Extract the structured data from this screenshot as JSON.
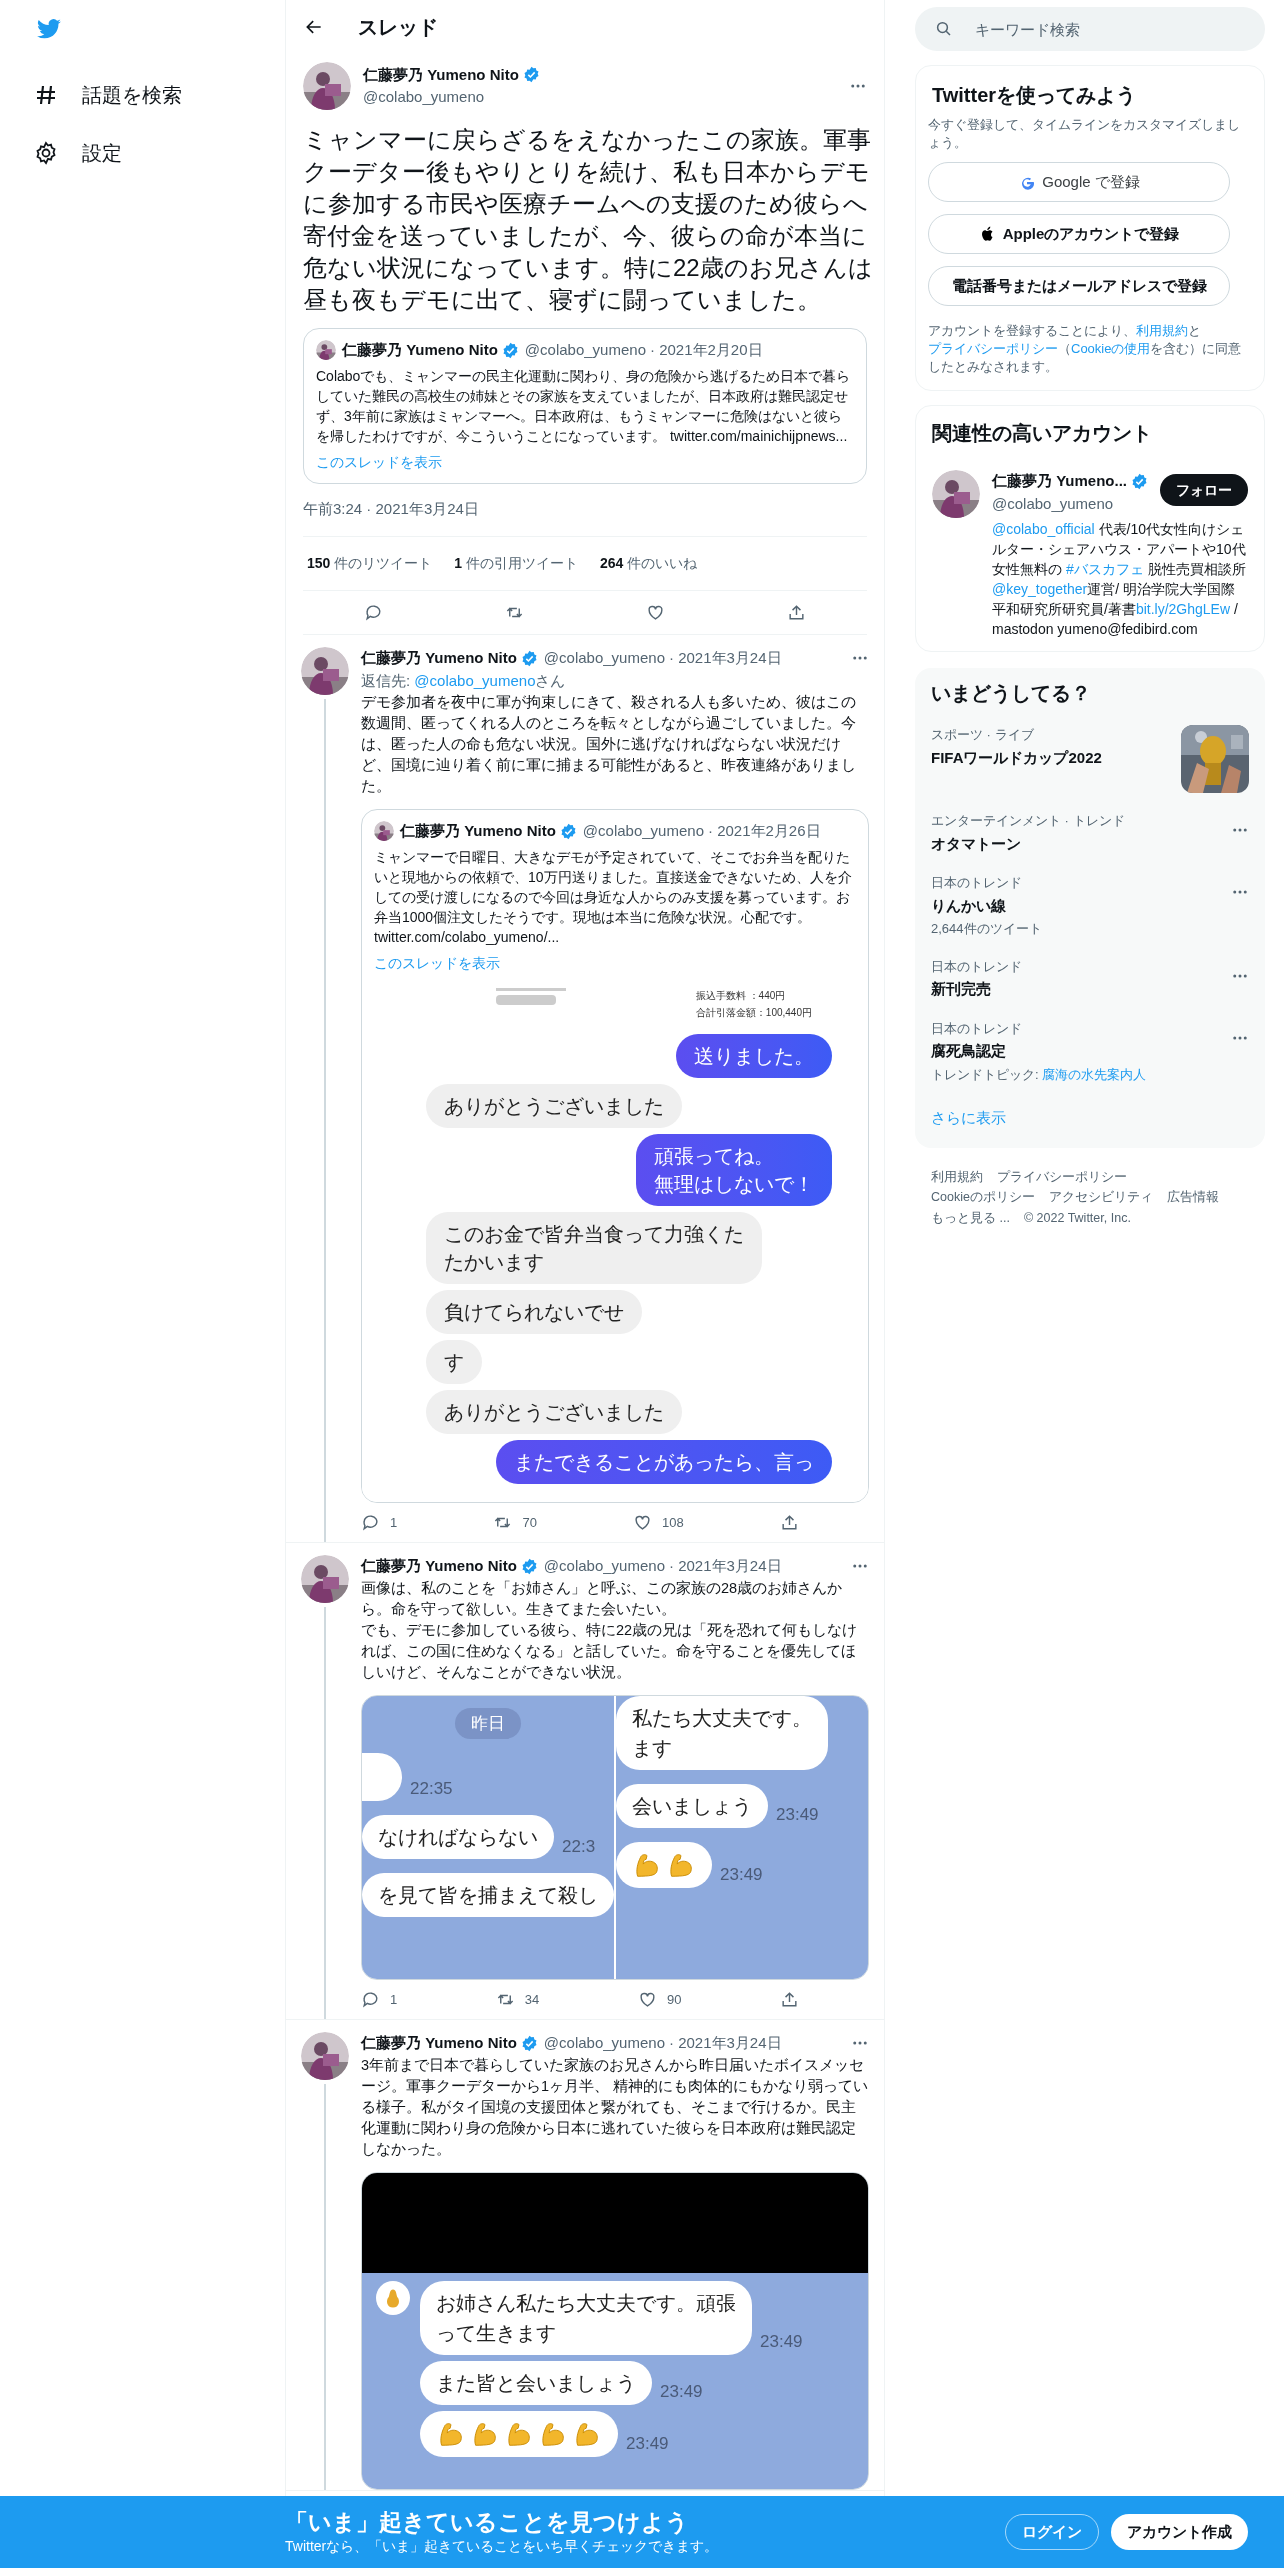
{
  "nav": {
    "items": [
      {
        "label": "話題を検索",
        "kind": "hashtag"
      },
      {
        "label": "設定",
        "kind": "settings"
      }
    ]
  },
  "header": {
    "title": "スレッド"
  },
  "main_tweet": {
    "author": "仁藤夢乃 Yumeno Nito",
    "handle": "@colabo_yumeno",
    "text": "ミャンマーに戻らざるをえなかったこの家族。軍事クーデター後もやりとりを続け、私も日本からデモに参加する市民や医療チームへの支援のため彼らへ寄付金を送っていましたが、今、彼らの命が本当に危ない状況になっています。特に22歳のお兄さんは昼も夜もデモに出て、寝ずに闘っていました。",
    "quote": {
      "author": "仁藤夢乃 Yumeno Nito",
      "handle": "@colabo_yumeno",
      "date": "· 2021年2月20日",
      "text": "Colaboでも、ミャンマーの民主化運動に関わり、身の危険から逃げるため日本で暮らしていた難民の高校生の姉妹とその家族を支えていましたが、日本政府は難民認定せず、3年前に家族はミャンマーへ。日本政府は、もうミャンマーに危険はないと彼らを帰したわけですが、今こういうことになっています。",
      "link": "twitter.com/mainichijpnews...",
      "show_thread": "このスレッドを表示"
    },
    "timestamp": "午前3:24 · 2021年3月24日",
    "stats": [
      {
        "count": "150",
        "label": "件のリツイート"
      },
      {
        "count": "1",
        "label": "件の引用ツイート"
      },
      {
        "count": "264",
        "label": "件のいいね"
      }
    ]
  },
  "replies": [
    {
      "author": "仁藤夢乃 Yumeno Nito",
      "handle": "@colabo_yumeno",
      "date": "· 2021年3月24日",
      "reply_to": {
        "prefix": "返信先: ",
        "link": "@colabo_yumeno",
        "suffix": "さん"
      },
      "paragraphs": [
        "デモ参加者を夜中に軍が拘束しにきて、殺される人も多いため、彼はこの数週間、匿ってくれる人のところを転々としながら過ごしていました。今は、匿った人の命も危ない状況。国外に逃げなければならない状況だけど、国境に辿り着く前に軍に捕まる可能性があると、昨夜連絡がありました。"
      ],
      "quote": {
        "author": "仁藤夢乃 Yumeno Nito",
        "handle": "@colabo_yumeno",
        "date": "· 2021年2月26日",
        "text": "ミャンマーで日曜日、大きなデモが予定されていて、そこでお弁当を配りたいと現地からの依頼で、10万円送りました。直接送金できないため、人を介しての受け渡しになるので今回は身近な人からのみ支援を募っています。お弁当1000個注文したそうです。現地は本当に危険な状況。心配です。",
        "link": "twitter.com/colabo_yumeno/...",
        "show_thread": "このスレッドを表示",
        "media": {
          "kind": "chat",
          "receipt": [
            "振込手数料 ：440円",
            "合計引落金額：100,440円"
          ],
          "messages": [
            {
              "kind": "sent",
              "lines": [
                "送りました。"
              ]
            },
            {
              "kind": "received",
              "lines": [
                "ありがとうございました"
              ]
            },
            {
              "kind": "sent",
              "lines": [
                "頑張ってね。",
                "無理はしないで！"
              ]
            },
            {
              "kind": "received",
              "lines": [
                "このお金で皆弁当食って力強くた",
                "たかいます"
              ]
            },
            {
              "kind": "received",
              "lines": [
                "負けてられないでせ"
              ]
            },
            {
              "kind": "received",
              "lines": [
                "す"
              ]
            },
            {
              "kind": "received",
              "lines": [
                "ありがとうございました"
              ]
            },
            {
              "kind": "sent",
              "lines": [
                "またできることがあったら、言っ"
              ]
            }
          ]
        }
      },
      "actions": {
        "replies": "1",
        "retweets": "70",
        "likes": "108"
      }
    },
    {
      "author": "仁藤夢乃 Yumeno Nito",
      "handle": "@colabo_yumeno",
      "date": "· 2021年3月24日",
      "paragraphs": [
        "画像は、私のことを「お姉さん」と呼ぶ、この家族の28歳のお姉さんから。命を守って欲しい。生きてまた会いたい。",
        "でも、デモに参加している彼ら、特に22歳の兄は「死を恐れて何もしなければ、この国に住めなくなる」と話していた。命を守ることを優先してほしいけど、そんなことができない状況。"
      ],
      "media": {
        "kind": "chat_pair",
        "left": {
          "date": "昨日",
          "messages": [
            {
              "kind": "stub",
              "time": "22:35"
            },
            {
              "kind": "text",
              "lines": [
                "なければならない"
              ],
              "time": "22:3"
            },
            {
              "kind": "text",
              "lines": [
                "を見て皆を捕まえて殺し"
              ]
            }
          ]
        },
        "right": {
          "messages": [
            {
              "kind": "text",
              "lines": [
                "私たち大丈夫です。",
                "ます"
              ]
            },
            {
              "kind": "text",
              "lines": [
                "会いましょう"
              ],
              "time": "23:49"
            },
            {
              "kind": "emoji",
              "emoji": [
                {
                  "kind": "flexed_arm"
                },
                {
                  "kind": "flexed_arm"
                }
              ],
              "time": "23:49"
            }
          ]
        }
      },
      "actions": {
        "replies": "1",
        "retweets": "34",
        "likes": "90"
      }
    },
    {
      "author": "仁藤夢乃 Yumeno Nito",
      "handle": "@colabo_yumeno",
      "date": "· 2021年3月24日",
      "paragraphs": [
        "3年前まで日本で暮らしていた家族のお兄さんから昨日届いたボイスメッセージ。軍事クーデターから1ヶ月半、 精神的にも肉体的にもかなり弱っている様子。私がタイ国境の支援団体と繋がれても、そこまで行けるか。民主化運動に関わり身の危険から日本に逃れていた彼らを日本政府は難民認定しなかった。"
      ],
      "media": {
        "kind": "video",
        "messages": [
          {
            "kind": "text",
            "lines": [
              "お姉さん私たち大丈夫です。頑張",
              "って生きます"
            ],
            "time": "23:49"
          },
          {
            "kind": "text",
            "lines": [
              "また皆と会いましょう"
            ],
            "time": "23:49"
          },
          {
            "kind": "emoji",
            "emoji": [
              {
                "kind": "flexed_arm"
              },
              {
                "kind": "flexed_arm"
              },
              {
                "kind": "flexed_arm"
              },
              {
                "kind": "flexed_arm"
              },
              {
                "kind": "flexed_arm"
              }
            ],
            "time": "23:49"
          }
        ]
      }
    }
  ],
  "search": {
    "placeholder": "キーワード検索"
  },
  "signup": {
    "title": "Twitterを使ってみよう",
    "subtitle": "今すぐ登録して、タイムラインをカスタマイズしましょう。",
    "buttons": [
      {
        "label": "Google で登録",
        "kind": "google"
      },
      {
        "label": "Appleのアカウントで登録",
        "kind": "apple"
      },
      {
        "label": "電話番号またはメールアドレスで登録",
        "kind": "plain"
      }
    ],
    "legal": [
      {
        "text": "アカウントを登録することにより、",
        "link": false
      },
      {
        "text": "利用規約",
        "link": true
      },
      {
        "text": "と",
        "link": false
      },
      {
        "text": "プライバシーポリシー",
        "link": true
      },
      {
        "text": "（",
        "link": false
      },
      {
        "text": "Cookieの使用",
        "link": true
      },
      {
        "text": "を含む）に同意したとみなされます。",
        "link": false
      }
    ]
  },
  "who_to_follow": {
    "title": "関連性の高いアカウント",
    "account": {
      "name": "仁藤夢乃 Yumeno...",
      "handle": "@colabo_yumeno",
      "button": "フォロー",
      "bio": [
        {
          "text": "@colabo_official",
          "link": true
        },
        {
          "text": " 代表/10代女性向けシェルター・シェアハウス・アパートや10代女性無料の ",
          "link": false
        },
        {
          "text": "#バスカフェ",
          "link": true
        },
        {
          "text": " 脱性売買相談所 ",
          "link": false
        },
        {
          "text": "@key_together",
          "link": true
        },
        {
          "text": "運営/ 明治学院大学国際平和研究所研究員/著書",
          "link": false
        },
        {
          "text": "bit.ly/2GhgLEw",
          "link": true
        },
        {
          "text": " /mastodon yumeno@fedibird.com",
          "link": false
        }
      ]
    }
  },
  "trends": {
    "title": "いまどうしてる？",
    "items": [
      {
        "category": "スポーツ · ライブ",
        "name": "FIFAワールドカップ2022"
      },
      {
        "category": "エンターテインメント · トレンド",
        "name": "オタマトーン"
      },
      {
        "category": "日本のトレンド",
        "name": "りんかい線",
        "meta": "2,644件のツイート"
      },
      {
        "category": "日本のトレンド",
        "name": "新刊完売"
      },
      {
        "category": "日本のトレンド",
        "name": "腐死鳥認定",
        "topic_label": "トレンドトピック: ",
        "topic_link": "腐海の水先案内人"
      }
    ],
    "show_more": "さらに表示"
  },
  "footer": {
    "links": [
      "利用規約",
      "プライバシーポリシー",
      "Cookieのポリシー",
      "アクセシビリティ",
      "広告情報",
      "もっと見る ..."
    ],
    "copyright": "© 2022 Twitter, Inc."
  },
  "bottom_bar": {
    "title": "「いま」起きていることを見つけよう",
    "subtitle": "Twitterなら、「いま」起きていることをいち早くチェックできます。",
    "login": "ログイン",
    "signup": "アカウント作成"
  }
}
